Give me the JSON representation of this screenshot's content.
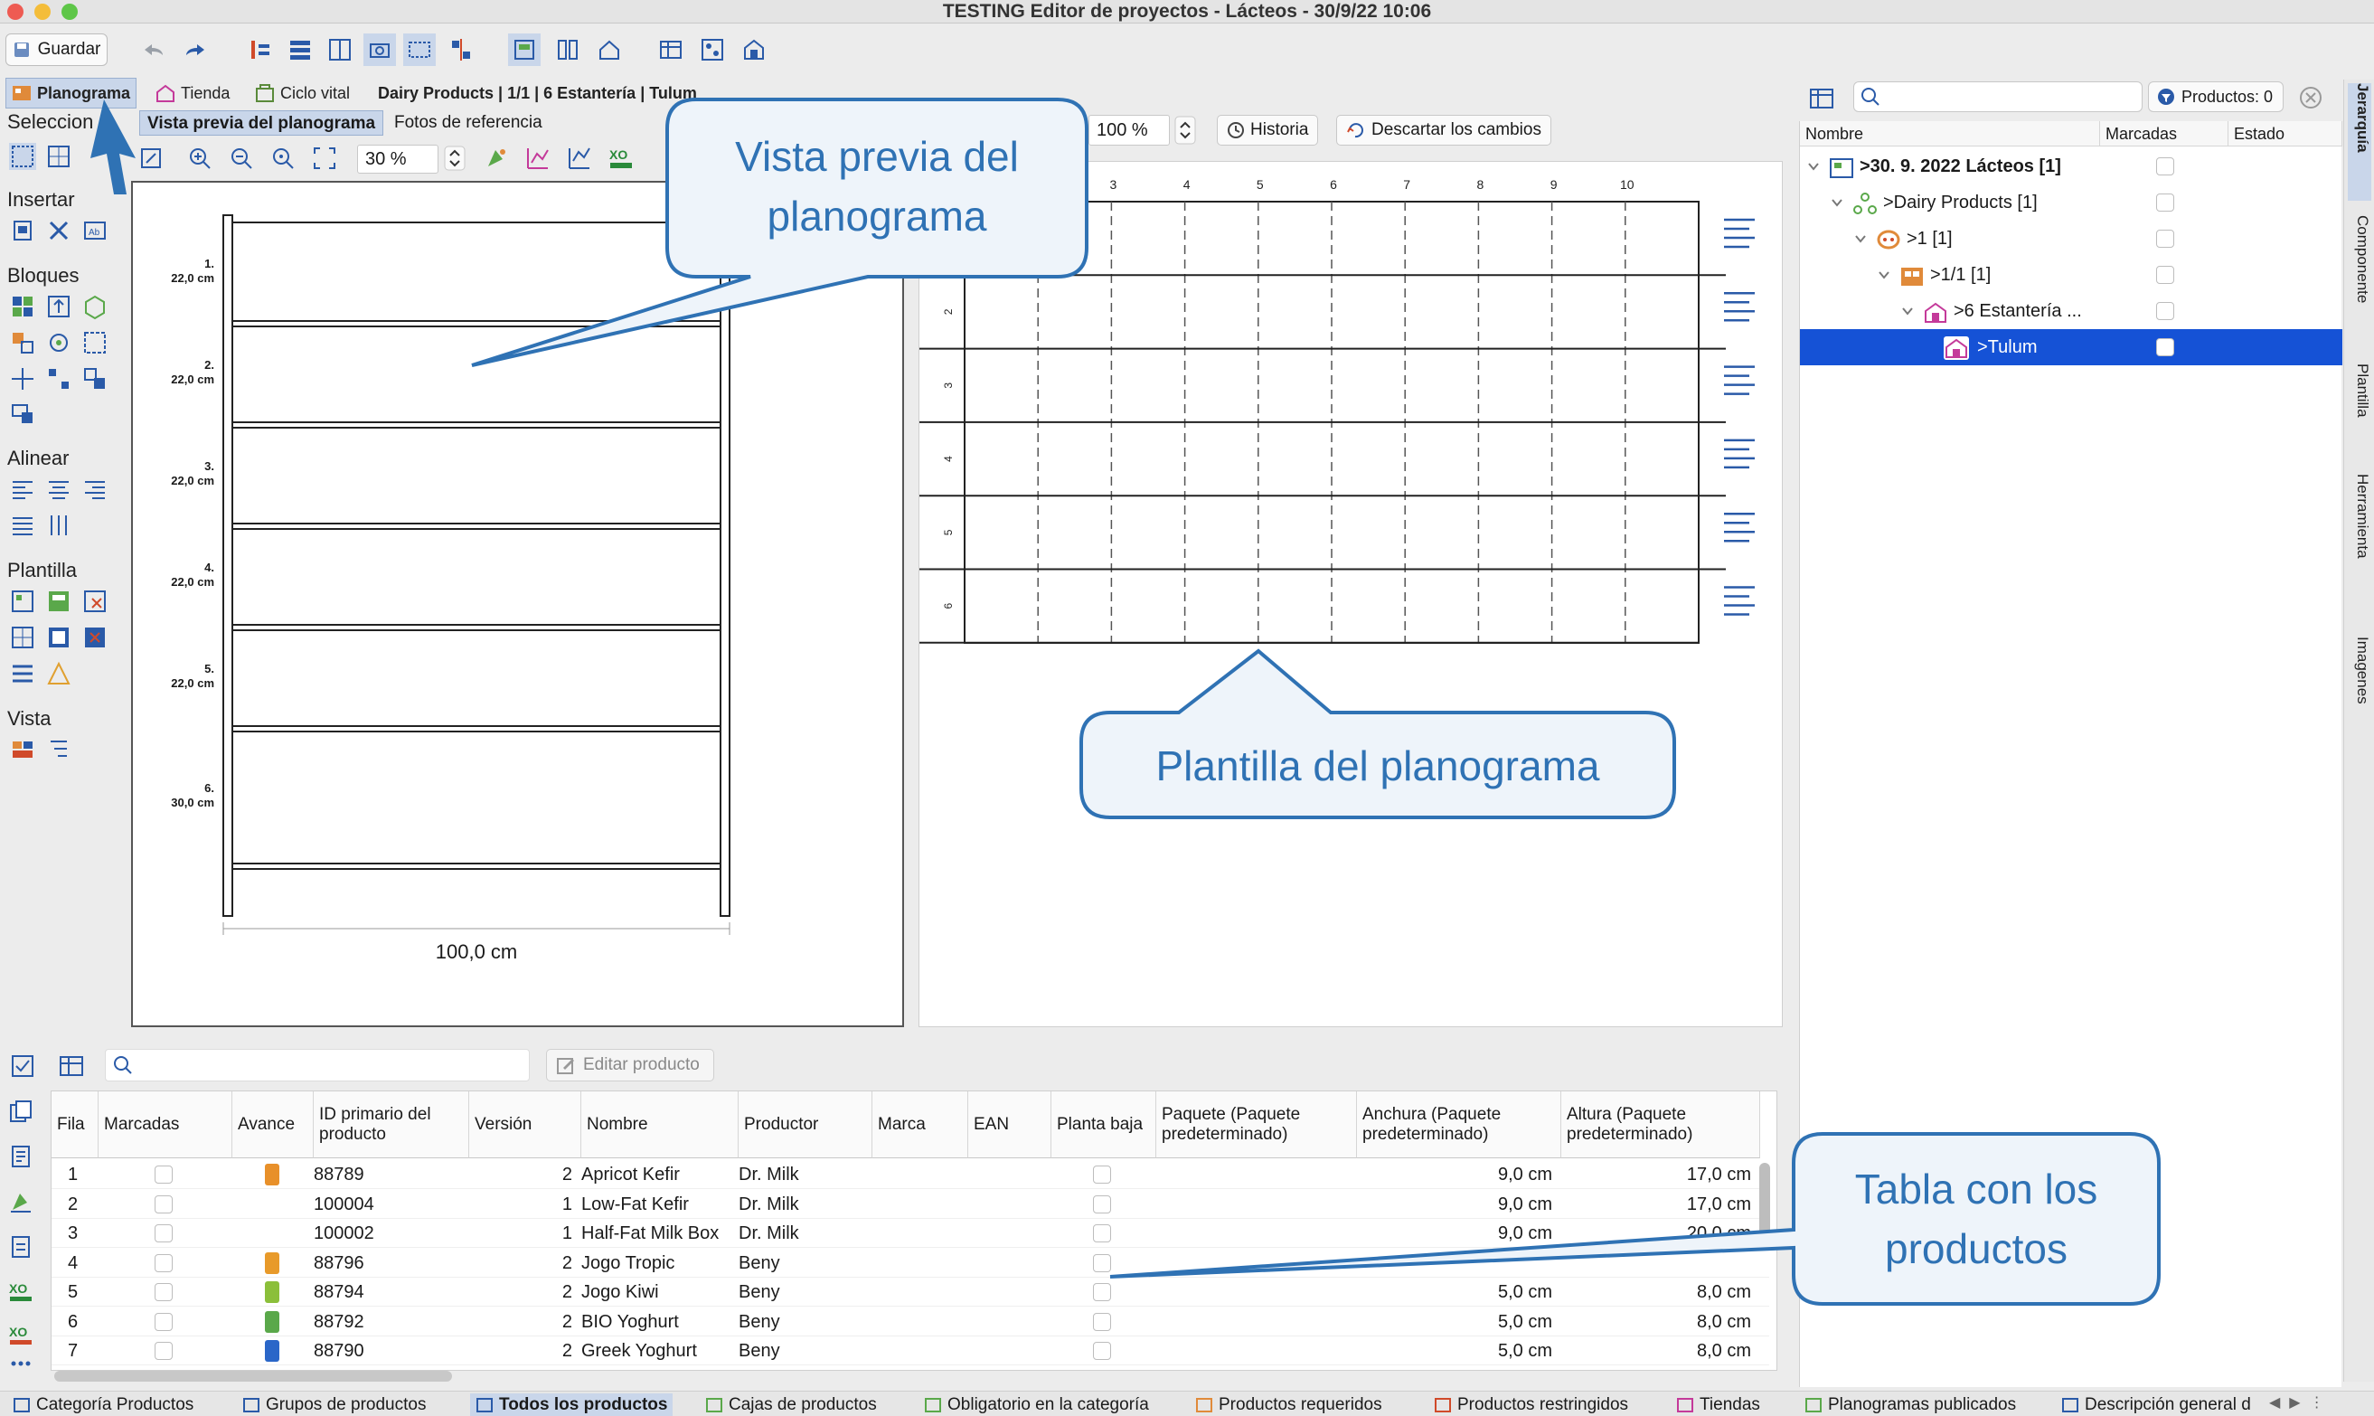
{
  "window": {
    "title": "TESTING Editor de proyectos - Lácteos - 30/9/22 10:06"
  },
  "toolbar": {
    "save_label": "Guardar"
  },
  "tabs": [
    {
      "label": "Planograma"
    },
    {
      "label": "Tienda"
    },
    {
      "label": "Ciclo vital"
    }
  ],
  "breadcrumb": "Dairy Products | 1/1 | 6 Estantería | Tulum",
  "left_panel": {
    "sections": [
      "Seleccion",
      "Insertar",
      "Bloques",
      "Alinear",
      "Plantilla",
      "Vista"
    ]
  },
  "preview": {
    "tabs": [
      "Vista previa del planograma",
      "Fotos de referencia"
    ],
    "zoom": "30 %",
    "shelves": [
      {
        "num": "1.",
        "height": "22,0 cm"
      },
      {
        "num": "2.",
        "height": "22,0 cm"
      },
      {
        "num": "3.",
        "height": "22,0 cm"
      },
      {
        "num": "4.",
        "height": "22,0 cm"
      },
      {
        "num": "5.",
        "height": "22,0 cm"
      },
      {
        "num": "6.",
        "height": "30,0 cm"
      }
    ],
    "width_label": "100,0 cm"
  },
  "template": {
    "zoom": "100 %",
    "history_label": "Historia",
    "discard_label": "Descartar los cambios",
    "col_labels": [
      "3",
      "4",
      "5",
      "6",
      "7",
      "8",
      "9",
      "10"
    ],
    "row_labels": [
      "2",
      "3",
      "4",
      "5",
      "6"
    ]
  },
  "right_panel": {
    "products_label": "Productos: 0",
    "columns": [
      "Nombre",
      "Marcadas",
      "Estado"
    ],
    "tree": [
      {
        "label": ">30. 9. 2022 Lácteos [1]",
        "bold": true
      },
      {
        "label": ">Dairy Products [1]"
      },
      {
        "label": ">1 [1]"
      },
      {
        "label": ">1/1 [1]"
      },
      {
        "label": ">6 Estantería ..."
      },
      {
        "label": ">Tulum",
        "selected": true
      }
    ]
  },
  "side_tabs": [
    "Jerarquía",
    "Componente",
    "Plantilla",
    "Herramienta",
    "Imagenes"
  ],
  "table": {
    "edit_label": "Editar producto",
    "columns": [
      "Fila",
      "Marcadas",
      "Avance",
      "ID primario del producto",
      "Versión",
      "Nombre",
      "Productor",
      "Marca",
      "EAN",
      "Planta baja",
      "Paquete (Paquete predeterminado)",
      "Anchura (Paquete predeterminado)",
      "Altura (Paquete predeterminado)"
    ],
    "rows": [
      {
        "fila": "1",
        "id": "88789",
        "version": "2",
        "name": "Apricot Kefir",
        "producer": "Dr. Milk",
        "width": "9,0 cm",
        "height": "17,0 cm",
        "thumb": "#e8902a"
      },
      {
        "fila": "2",
        "id": "100004",
        "version": "1",
        "name": "Low-Fat Kefir",
        "producer": "Dr. Milk",
        "width": "9,0 cm",
        "height": "17,0 cm",
        "thumb": ""
      },
      {
        "fila": "3",
        "id": "100002",
        "version": "1",
        "name": "Half-Fat Milk Box",
        "producer": "Dr. Milk",
        "width": "9,0 cm",
        "height": "20,0 cm",
        "thumb": ""
      },
      {
        "fila": "4",
        "id": "88796",
        "version": "2",
        "name": "Jogo Tropic",
        "producer": "Beny",
        "width": "",
        "height": "",
        "thumb": "#e89a2a"
      },
      {
        "fila": "5",
        "id": "88794",
        "version": "2",
        "name": "Jogo Kiwi",
        "producer": "Beny",
        "width": "5,0 cm",
        "height": "8,0 cm",
        "thumb": "#8bbf3a"
      },
      {
        "fila": "6",
        "id": "88792",
        "version": "2",
        "name": "BIO Yoghurt",
        "producer": "Beny",
        "width": "5,0 cm",
        "height": "8,0 cm",
        "thumb": "#5aa84a"
      },
      {
        "fila": "7",
        "id": "88790",
        "version": "2",
        "name": "Greek Yoghurt",
        "producer": "Beny",
        "width": "5,0 cm",
        "height": "8,0 cm",
        "thumb": "#2a66c8"
      }
    ]
  },
  "bottom_tabs": [
    "Categoría Productos",
    "Grupos de productos",
    "Todos los productos",
    "Cajas de productos",
    "Obligatorio en la categoría",
    "Productos requeridos",
    "Productos restringidos",
    "Tiendas",
    "Planogramas publicados",
    "Descripción general d"
  ],
  "callouts": {
    "preview_line1": "Vista previa del",
    "preview_line2": "planograma",
    "template": "Plantilla del planograma",
    "table_line1": "Tabla con los",
    "table_line2": "productos"
  },
  "colors": {
    "accent": "#1552d6",
    "callout_border": "#2f72b4",
    "callout_fill": "#eef4fa"
  }
}
